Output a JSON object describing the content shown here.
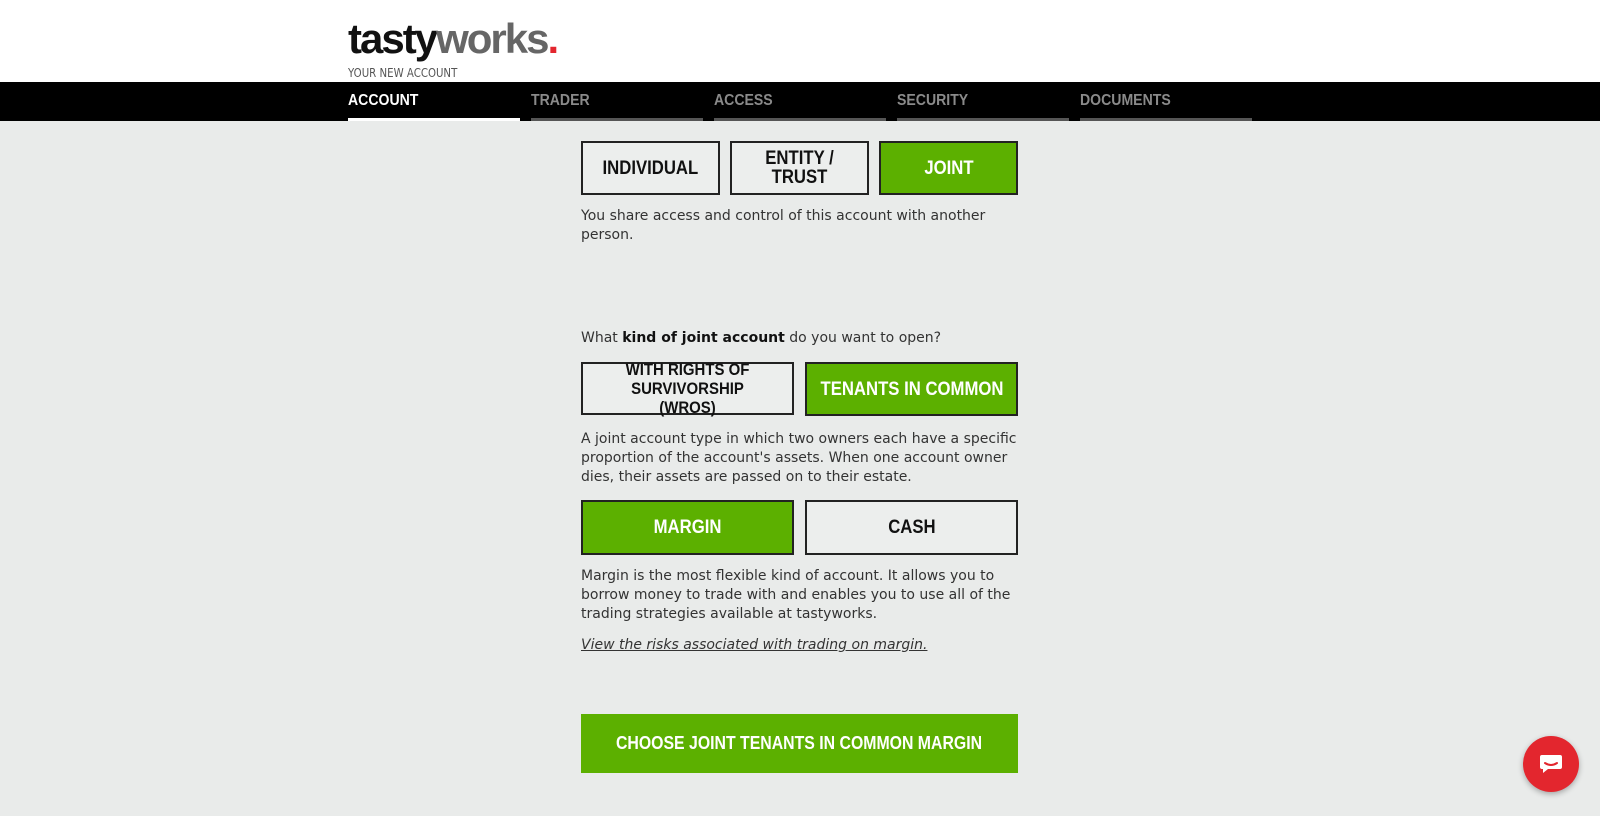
{
  "brand": {
    "logo_part1": "tasty",
    "logo_part2": "works",
    "logo_dot": ".",
    "subtitle": "YOUR NEW ACCOUNT"
  },
  "nav": {
    "tabs": [
      {
        "label": "ACCOUNT",
        "active": true
      },
      {
        "label": "TRADER",
        "active": false
      },
      {
        "label": "ACCESS",
        "active": false
      },
      {
        "label": "SECURITY",
        "active": false
      },
      {
        "label": "DOCUMENTS",
        "active": false
      }
    ]
  },
  "account_type": {
    "options": [
      "INDIVIDUAL",
      "ENTITY / TRUST",
      "JOINT"
    ],
    "selected": "JOINT",
    "description": "You share access and control of this account with another person."
  },
  "joint_kind": {
    "question_pre": "What ",
    "question_bold": "kind of joint account",
    "question_post": " do you want to open?",
    "options": [
      "WITH RIGHTS OF SURVIVORSHIP (WROS)",
      "TENANTS IN COMMON"
    ],
    "selected": "TENANTS IN COMMON",
    "description": "A joint account type in which two owners each have a specific proportion of the account's assets. When one account owner dies, their assets are passed on to their estate."
  },
  "margin_type": {
    "options": [
      "MARGIN",
      "CASH"
    ],
    "selected": "MARGIN",
    "description": "Margin is the most flexible kind of account. It allows you to borrow money to trade with and enables you to use all of the trading strategies available at tastyworks.",
    "risk_link": "View the risks associated with trading on margin."
  },
  "cta": {
    "label": "CHOOSE JOINT TENANTS IN COMMON MARGIN"
  },
  "colors": {
    "accent_green": "#5cb000",
    "brand_red": "#e3262e",
    "background": "#e9ebea"
  },
  "icons": {
    "chat": "chat-bubble-icon"
  }
}
